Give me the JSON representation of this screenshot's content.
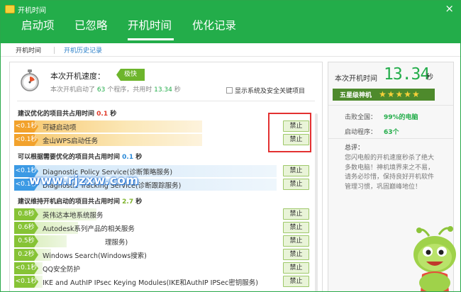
{
  "window": {
    "title": "开机时间",
    "close_label": "×"
  },
  "tabs": [
    {
      "label": "启动项"
    },
    {
      "label": "已忽略"
    },
    {
      "label": "开机时间",
      "active": true
    },
    {
      "label": "优化记录"
    }
  ],
  "subtabs": [
    {
      "label": "开机时间",
      "active": true
    },
    {
      "label": "开机历史记录"
    }
  ],
  "speed": {
    "label": "本次开机速度：",
    "badge": "极快",
    "desc_pre": "本次开机启动了",
    "count": "63",
    "desc_mid": "个程序，共用时",
    "time": "13.34",
    "desc_unit": "秒",
    "show_system_label": "显示系统及安全关键项目",
    "show_system_checked": false
  },
  "sections": [
    {
      "title": "建议优化的项目共占用时间",
      "time": "0.1",
      "unit": "秒",
      "color": "red",
      "items": [
        {
          "time": "<0.1秒",
          "name": "可疑启动项",
          "action": "禁止",
          "bold": false
        },
        {
          "time": "<0.1秒",
          "name": "金山WPS启动任务",
          "action": "禁止",
          "bold": false
        }
      ]
    },
    {
      "title": "可以根据需要优化的项目共占用时间",
      "time": "0.1",
      "unit": "秒",
      "color": "blue",
      "items": [
        {
          "time": "<0.1秒",
          "name": "Diagnostic Policy Service(诊断策略服务)",
          "action": "禁止",
          "bold": true
        },
        {
          "time": "<0.1秒",
          "name": "Diagnostic Tracking Service(诊断跟踪服务)",
          "action": "禁止",
          "bold": true
        }
      ]
    },
    {
      "title": "建议维持开机启动的项目共占用时间",
      "time": "2.7",
      "unit": "秒",
      "color": "green",
      "items": [
        {
          "time": "0.8秒",
          "name": "英伟达本地系统服务",
          "action": "禁止",
          "bold": true
        },
        {
          "time": "0.6秒",
          "name": "Autodesk系列产品的相关服务",
          "action": "禁止",
          "bold": true
        },
        {
          "time": "0.5秒",
          "name": "理服务)",
          "action": "禁止",
          "bold": true
        },
        {
          "time": "0.2秒",
          "name": "Windows Search(Windows搜索)",
          "action": "禁止",
          "bold": true
        },
        {
          "time": "<0.1秒",
          "name": "QQ安全防护",
          "action": "禁止",
          "bold": true
        },
        {
          "time": "<0.1秒",
          "name": "IKE and AuthIP IPsec Keying Modules(IKE和AuthIP IPSec密钥服务)",
          "action": "禁止",
          "bold": true
        }
      ]
    }
  ],
  "watermark": "www.rjzxw.com",
  "summary": {
    "label": "本次开机时间",
    "time": "13.34",
    "unit": "秒",
    "rank_title": "五星级神机",
    "stars": "★★★★★",
    "rating": 5,
    "beat_label": "击败全国：",
    "beat_value": "99%的电脑",
    "programs_label": "启动程序：",
    "programs_value": "63个",
    "comment_label": "总评：",
    "comment_text": "您闪电般的开机速度秒杀了绝大多数电脑！神机境界来之不易，请务必珍惜，保持良好开机软件管理习惯，巩固巅峰地位！"
  },
  "colors": {
    "brand": "#23ad4a",
    "red": "#e03a2a",
    "blue": "#2b8ad8",
    "green": "#7db22a"
  }
}
